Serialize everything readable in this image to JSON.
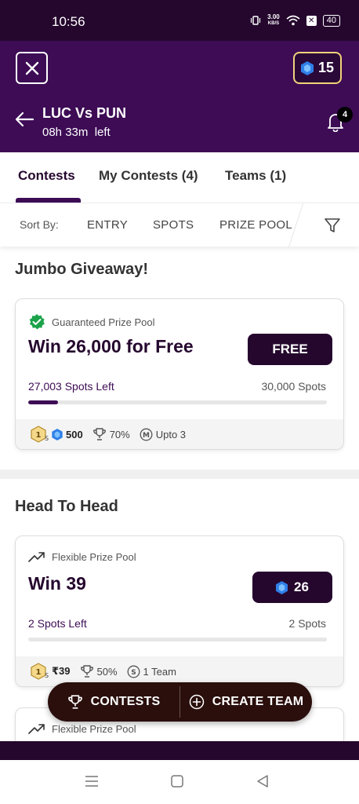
{
  "status_bar": {
    "time": "10:56",
    "net_speed_top": "3.00",
    "net_speed_bottom": "KB/S",
    "battery": "40"
  },
  "header": {
    "coins": "15",
    "match_title": "LUC Vs PUN",
    "time_left": "08h 33m",
    "time_left_suffix": "left",
    "notification_count": "4"
  },
  "tabs": [
    {
      "label": "Contests",
      "active": true
    },
    {
      "label": "My Contests (4)",
      "active": false
    },
    {
      "label": "Teams (1)",
      "active": false
    }
  ],
  "sort": {
    "label": "Sort By:",
    "options": [
      "ENTRY",
      "SPOTS",
      "PRIZE POOL"
    ]
  },
  "sections": [
    {
      "title": "Jumbo Giveaway!",
      "cards": [
        {
          "tag": "Guaranteed Prize Pool",
          "title": "Win 26,000 for Free",
          "entry_label": "FREE",
          "spots_left": "27,003 Spots Left",
          "spots_total": "30,000 Spots",
          "fill_fraction": 0.1,
          "footer": {
            "first_prize": "500",
            "win_percent": "70%",
            "multi": "Upto 3"
          }
        }
      ]
    },
    {
      "title": "Head To Head",
      "cards": [
        {
          "tag": "Flexible Prize Pool",
          "title": "Win 39",
          "entry_label": "26",
          "spots_left": "2 Spots Left",
          "spots_total": "2 Spots",
          "fill_fraction": 0,
          "footer": {
            "first_prize": "₹39",
            "win_percent": "50%",
            "single": "1 Team"
          }
        },
        {
          "tag": "Flexible Prize Pool"
        }
      ]
    }
  ],
  "fab": {
    "contests_label": "CONTESTS",
    "create_team_label": "CREATE TEAM"
  },
  "colors": {
    "brand_dark": "#25072e",
    "brand": "#3d0c55",
    "coin_border": "#f2d27a",
    "verified_green": "#1aa34a"
  }
}
